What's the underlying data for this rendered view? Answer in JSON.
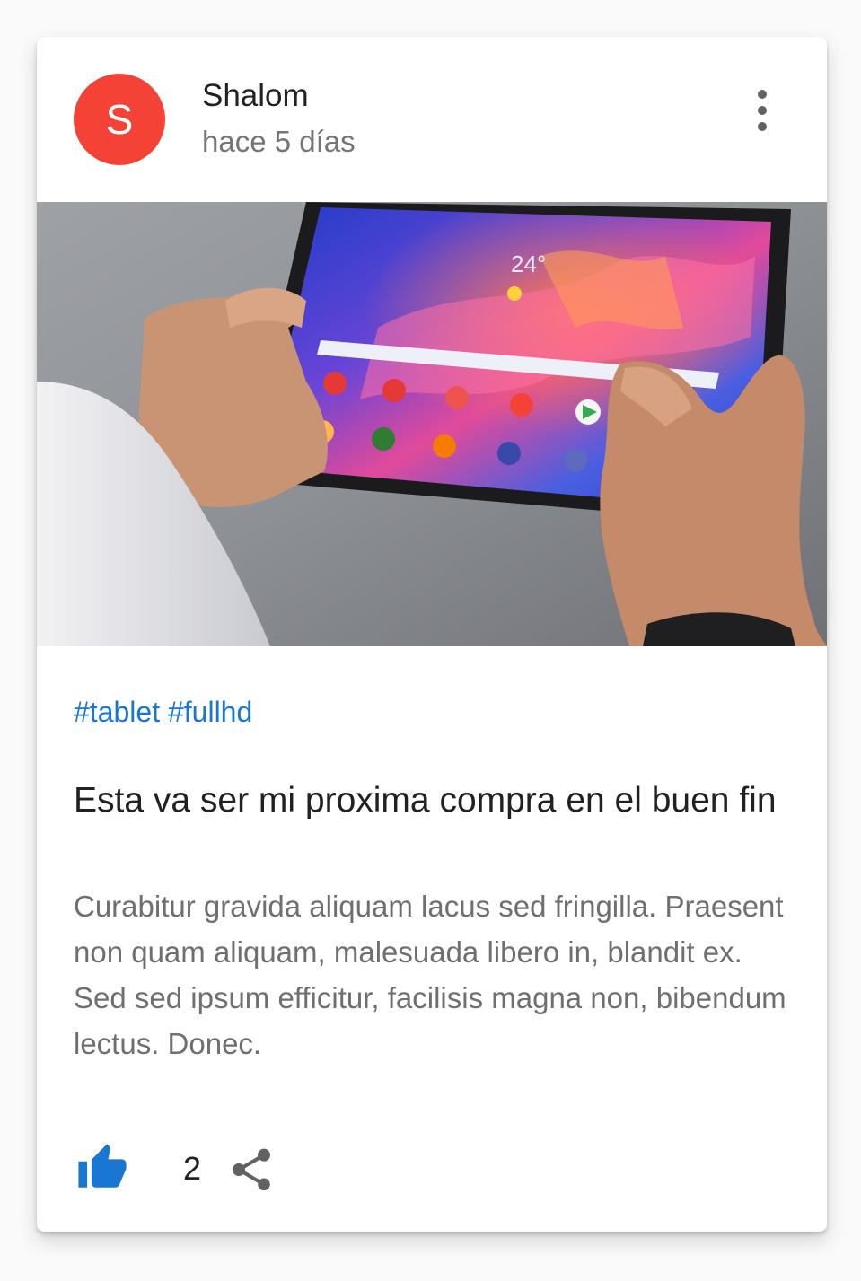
{
  "post": {
    "author": {
      "initial": "S",
      "name": "Shalom",
      "avatar_color": "#f44336"
    },
    "time_ago": "hace 5 días",
    "menu_icon": "more-vert-icon",
    "image": {
      "subject": "Hands holding a tablet showing a home screen",
      "screen_temperature": "24°"
    },
    "hashtags": [
      "#tablet",
      "#fullhd"
    ],
    "title": "Esta va ser mi proxima compra en el buen fin",
    "body": "Curabitur gravida aliquam lacus sed fringilla. Praesent non quam aliquam, malesuada libero in, blandit ex. Sed sed ipsum efficitur, facilisis magna non, bibendum lectus. Donec.",
    "likes": "2",
    "like_icon": "thumb-up-icon",
    "share_icon": "share-icon"
  },
  "colors": {
    "accent": "#1976d2",
    "title": "#212121",
    "secondary_text": "#757575"
  }
}
